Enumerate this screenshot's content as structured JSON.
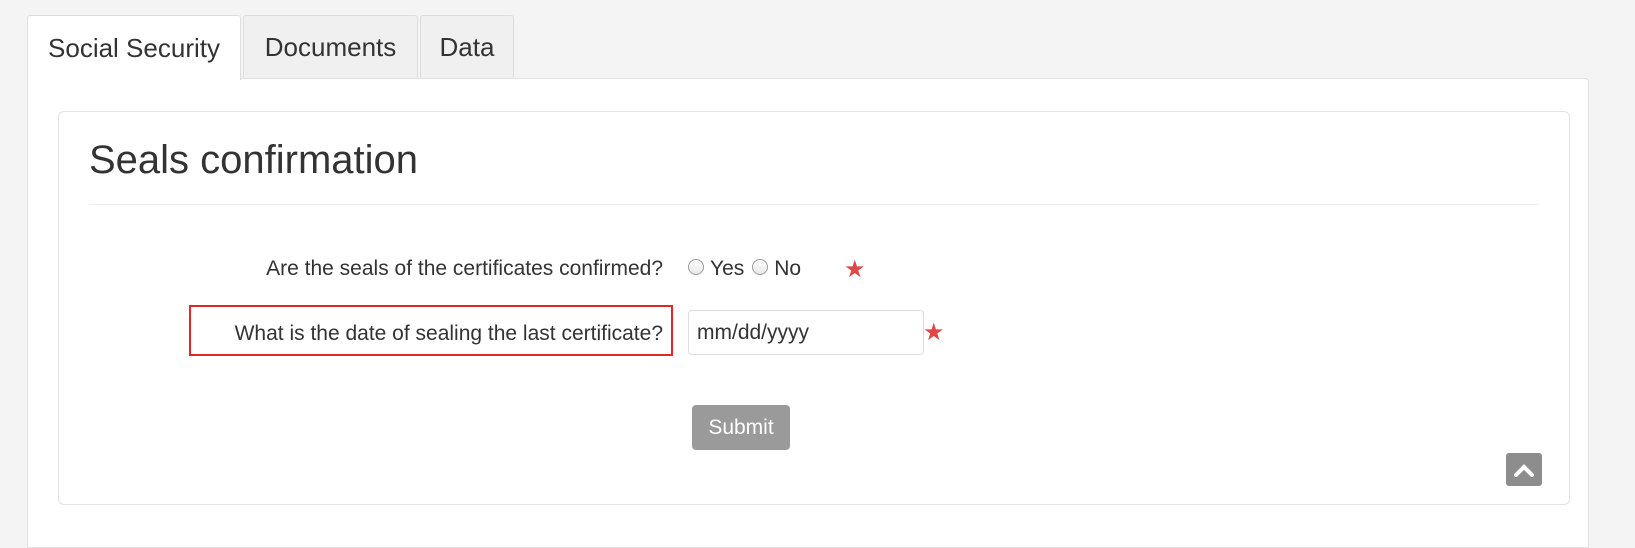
{
  "tabs": [
    {
      "label": "Social Security",
      "active": true
    },
    {
      "label": "Documents",
      "active": false
    },
    {
      "label": "Data",
      "active": false
    }
  ],
  "panel": {
    "title": "Seals confirmation"
  },
  "form": {
    "seals_question": "Are the seals of the certificates confirmed?",
    "seals_options": {
      "yes": "Yes",
      "no": "No"
    },
    "date_question": "What is the date of sealing the last certificate?",
    "date_placeholder": "mm/dd/yyyy",
    "required_marker": "★",
    "submit_label": "Submit"
  },
  "icons": {
    "scroll_top": "chevron-up-icon",
    "required": "star-icon"
  },
  "colors": {
    "required_star": "#e04848",
    "highlight_border": "#e32626",
    "submit_bg": "#9a9a9a",
    "scroll_top_bg": "#8d8d8d"
  }
}
